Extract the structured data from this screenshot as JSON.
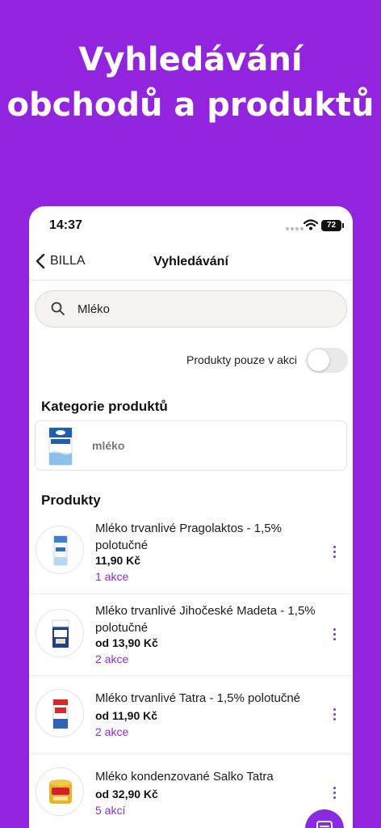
{
  "headline": {
    "line1": "Vyhledávání",
    "line2": "obchodů a produktů"
  },
  "status_bar": {
    "time": "14:37",
    "battery": "72"
  },
  "nav": {
    "back_label": "BILLA",
    "title": "Vyhledávání"
  },
  "search": {
    "value": "Mléko"
  },
  "filter": {
    "label": "Produkty pouze v akci",
    "on": false
  },
  "categories": {
    "title": "Kategorie produktů",
    "items": [
      {
        "label": "mléko"
      }
    ]
  },
  "products": {
    "title": "Produkty",
    "items": [
      {
        "name": "Mléko trvanlivé Pragolaktos  - 1,5% polotučné",
        "price": "11,90 Kč",
        "deals": "1 akce"
      },
      {
        "name": "Mléko trvanlivé Jihočeské Madeta - 1,5% polotučné",
        "price": "od 13,90 Kč",
        "deals": "2 akce"
      },
      {
        "name": "Mléko trvanlivé Tatra - 1,5% polotučné",
        "price": "od 11,90 Kč",
        "deals": "2 akce"
      },
      {
        "name": "Mléko kondenzované Salko Tatra",
        "price": "od 32,90 Kč",
        "deals": "5 akcí"
      }
    ]
  },
  "colors": {
    "background": "#9224e0",
    "accent": "#8a2be2"
  },
  "icons": {
    "back": "chevron-left-icon",
    "search": "search-icon",
    "more": "more-vertical-icon",
    "fab": "list-icon"
  }
}
